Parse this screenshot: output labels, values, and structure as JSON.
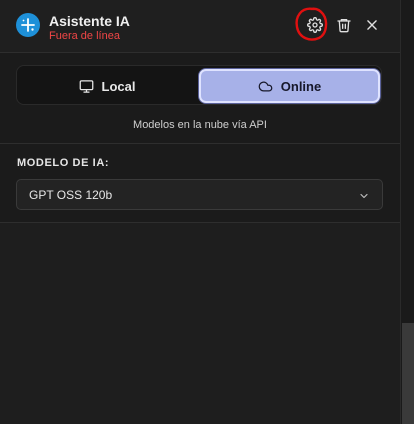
{
  "header": {
    "title": "Asistente IA",
    "status": "Fuera de línea",
    "status_color": "#f04646",
    "logo_icon": "sparkle-plus-icon",
    "actions": [
      {
        "name": "settings",
        "icon": "gear-icon"
      },
      {
        "name": "delete",
        "icon": "trash-icon"
      },
      {
        "name": "close",
        "icon": "close-icon"
      }
    ]
  },
  "mode": {
    "options": [
      {
        "label": "Local",
        "icon": "monitor-icon",
        "selected": false
      },
      {
        "label": "Online",
        "icon": "cloud-icon",
        "selected": true
      }
    ],
    "hint": "Modelos en la nube vía API",
    "accent": "#a7b1e8"
  },
  "model": {
    "label": "MODELO DE IA:",
    "selected": "GPT OSS 120b",
    "icon": "chevron-down-icon"
  }
}
